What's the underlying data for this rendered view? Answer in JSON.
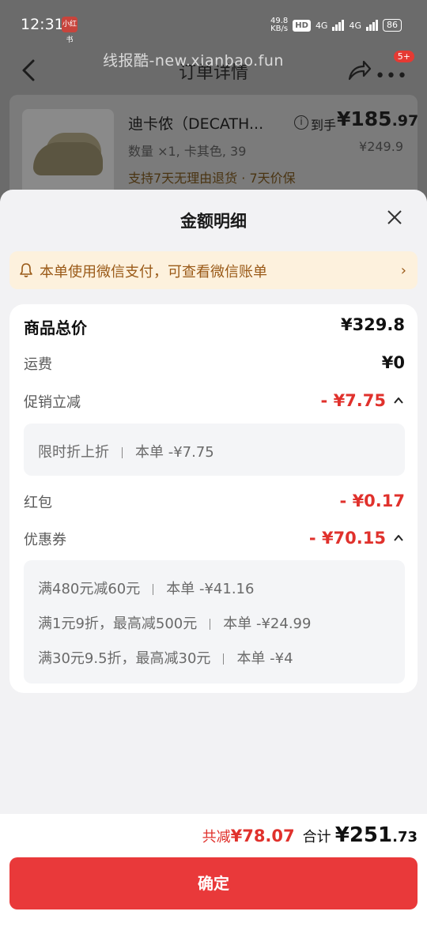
{
  "status": {
    "time": "12:31",
    "app_icon_text": "小红书",
    "net_speed": "49.8",
    "net_unit": "KB/s",
    "hd": "HD",
    "net1": "4G",
    "net2": "4G",
    "battery": "86"
  },
  "nav": {
    "title": "订单详情",
    "watermark": "线报酷-new.xianbao.fun",
    "badge": "5+"
  },
  "product": {
    "name": "迪卡侬（DECATH...",
    "spec": "数量 ×1, 卡其色, 39",
    "tags": "支持7天无理由退货 · 7天价保",
    "price_label": "到手",
    "price_main": "¥185",
    "price_decimal": ".97",
    "price_original": "¥249.9"
  },
  "sheet": {
    "title": "金额明细",
    "notice": "本单使用微信支付，可查看微信账单",
    "rows": {
      "total": {
        "label": "商品总价",
        "value": "¥329.8"
      },
      "shipping": {
        "label": "运费",
        "value": "¥0"
      },
      "promo": {
        "label": "促销立减",
        "value": "- ¥7.75"
      },
      "redpacket": {
        "label": "红包",
        "value": "- ¥0.17"
      },
      "coupon": {
        "label": "优惠券",
        "value": "- ¥70.15"
      }
    },
    "promo_detail": {
      "name": "限时折上折",
      "amount": "本单 -¥7.75"
    },
    "coupon_details": [
      {
        "name": "满480元减60元",
        "amount": "本单 -¥41.16"
      },
      {
        "name": "满1元9折，最高减500元",
        "amount": "本单 -¥24.99"
      },
      {
        "name": "满30元9.5折，最高减30元",
        "amount": "本单 -¥4"
      }
    ]
  },
  "footer": {
    "saved_label": "共减",
    "saved_value": "¥78.07",
    "total_label": "合计",
    "total_value": "¥251",
    "total_decimal": ".73",
    "confirm": "确定"
  },
  "colors": {
    "accent_red": "#e9393a",
    "notice_bg": "#fdf1dd",
    "notice_text": "#9a5a18"
  }
}
